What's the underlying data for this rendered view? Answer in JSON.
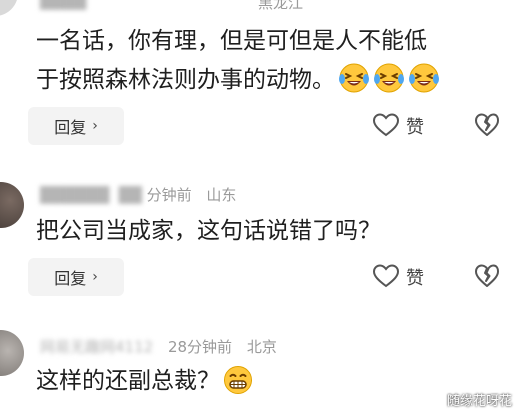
{
  "comments": [
    {
      "location": "黑龙江",
      "text_line1": "一名话，你有理，但是可但是人不能低",
      "text_line2": "于按照森林法则办事的动物。",
      "emoji": "laughing-crying-face",
      "reply_label": "回复",
      "like_label": "赞"
    },
    {
      "time": "分钟前",
      "location": "山东",
      "text": "把公司当成家，这句话说错了吗？",
      "reply_label": "回复",
      "like_label": "赞"
    },
    {
      "username": "网易无趣网4112",
      "time": "28分钟前",
      "location": "北京",
      "text": "这样的还副总裁？",
      "emoji": "grinning-face"
    }
  ],
  "watermark": "随缘花呀花",
  "colors": {
    "meta_gray": "#9a9a9a",
    "reply_bg": "#f3f3f3",
    "emoji_yellow": "#ffc83d"
  }
}
